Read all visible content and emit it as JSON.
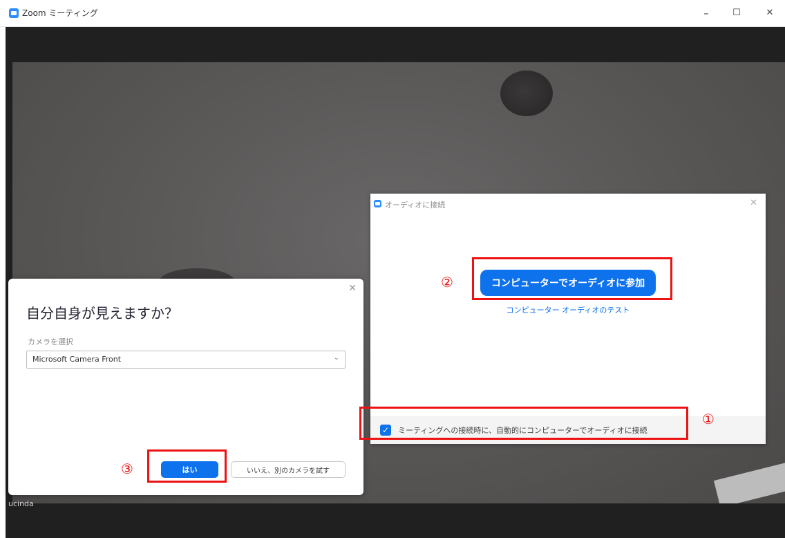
{
  "window": {
    "title": "Zoom ミーティング",
    "minimize": "–",
    "maximize": "☐",
    "close": "✕"
  },
  "video": {
    "participant_label": "ucinda"
  },
  "audio_dialog": {
    "title": "オーディオに接続",
    "close": "✕",
    "join_button": "コンピューターでオーディオに参加",
    "test_link": "コンピューター オーディオのテスト",
    "auto_join_checked": true,
    "auto_join_label": "ミーティングへの接続時に、自動的にコンピューターでオーディオに接続"
  },
  "camera_dialog": {
    "close": "✕",
    "heading": "自分自身が見えますか？",
    "select_label": "カメラを選択",
    "selected_camera": "Microsoft Camera Front",
    "yes_button": "はい",
    "no_button": "いいえ、別のカメラを試す"
  },
  "annotations": {
    "one": "①",
    "two": "②",
    "three": "③",
    "color": "#ee1111"
  },
  "icons": {
    "app": "zoom-logo-icon",
    "dropdown": "chevron-down-icon",
    "check": "checkmark-icon"
  },
  "colors": {
    "accent": "#0e72ed",
    "annotation": "#ee1111"
  }
}
